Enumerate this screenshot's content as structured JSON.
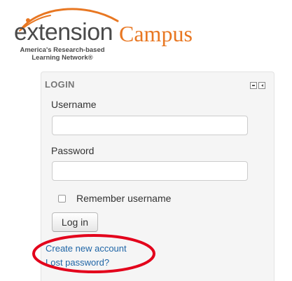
{
  "logo": {
    "brand_text": "extension",
    "campus_text": "Campus",
    "tagline_line1": "America's Research-based",
    "tagline_line2": "Learning Network®"
  },
  "login_block": {
    "title": "LOGIN",
    "username_label": "Username",
    "username_value": "",
    "password_label": "Password",
    "password_value": "",
    "remember_label": "Remember username",
    "remember_checked": false,
    "login_button": "Log in",
    "create_account_link": "Create new account",
    "lost_password_link": "Lost password?"
  },
  "colors": {
    "brand_orange": "#e87722",
    "link_blue": "#1f65a6",
    "highlight_red": "#e3001b",
    "block_bg": "#f5f5f5"
  },
  "icons": {
    "hide_block": "minus-box-icon",
    "dock_block": "dock-left-icon"
  }
}
